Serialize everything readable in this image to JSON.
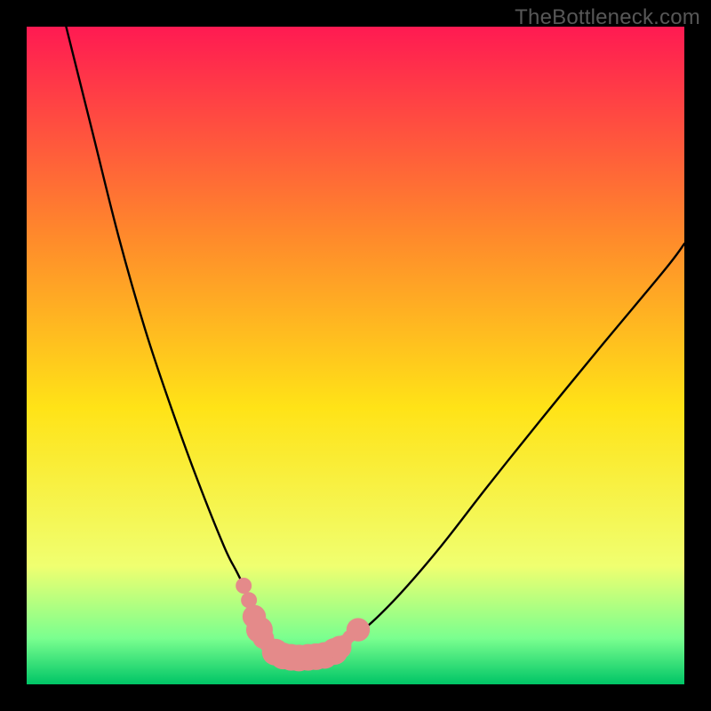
{
  "watermark": "TheBottleneck.com",
  "chart_data": {
    "type": "line",
    "title": "",
    "xlabel": "",
    "ylabel": "",
    "xlim": [
      0,
      100
    ],
    "ylim": [
      0,
      100
    ],
    "grid": false,
    "legend": false,
    "background_gradient": {
      "top": "#ff1a52",
      "upper_mid": "#ff8a2b",
      "mid": "#ffe317",
      "lower_mid": "#f0ff70",
      "band": "#7aff8f",
      "bottom": "#00c566"
    },
    "series": [
      {
        "name": "bottleneck-curve",
        "color": "#000000",
        "x": [
          6,
          10,
          14,
          18,
          22,
          26,
          30,
          32,
          34,
          35.5,
          37,
          38.5,
          40,
          42,
          45,
          48,
          52,
          57,
          63,
          70,
          78,
          87,
          97,
          100
        ],
        "y": [
          100,
          84,
          68,
          54,
          42,
          31,
          21,
          17,
          13,
          10,
          7.5,
          5.5,
          4.5,
          4.2,
          4.5,
          6,
          9,
          14,
          21,
          30,
          40,
          51,
          63,
          67
        ]
      }
    ],
    "markers": {
      "name": "highlight-dots",
      "color": "#e48a8a",
      "points": [
        {
          "x": 33.0,
          "y": 15.0,
          "r": 1.5
        },
        {
          "x": 33.8,
          "y": 12.8,
          "r": 1.5
        },
        {
          "x": 34.6,
          "y": 10.3,
          "r": 2.2
        },
        {
          "x": 35.4,
          "y": 8.3,
          "r": 2.5
        },
        {
          "x": 36.0,
          "y": 7.0,
          "r": 2.0
        },
        {
          "x": 36.6,
          "y": 6.0,
          "r": 1.4
        },
        {
          "x": 37.8,
          "y": 4.9,
          "r": 2.5
        },
        {
          "x": 39.0,
          "y": 4.3,
          "r": 2.5
        },
        {
          "x": 40.2,
          "y": 4.1,
          "r": 2.5
        },
        {
          "x": 41.4,
          "y": 4.0,
          "r": 2.5
        },
        {
          "x": 42.8,
          "y": 4.1,
          "r": 2.5
        },
        {
          "x": 44.0,
          "y": 4.2,
          "r": 2.5
        },
        {
          "x": 45.3,
          "y": 4.4,
          "r": 2.5
        },
        {
          "x": 46.8,
          "y": 5.0,
          "r": 2.5
        },
        {
          "x": 47.6,
          "y": 5.6,
          "r": 2.2
        },
        {
          "x": 48.3,
          "y": 6.4,
          "r": 1.4
        },
        {
          "x": 49.0,
          "y": 7.2,
          "r": 1.2
        },
        {
          "x": 50.4,
          "y": 8.3,
          "r": 2.2
        }
      ]
    }
  }
}
